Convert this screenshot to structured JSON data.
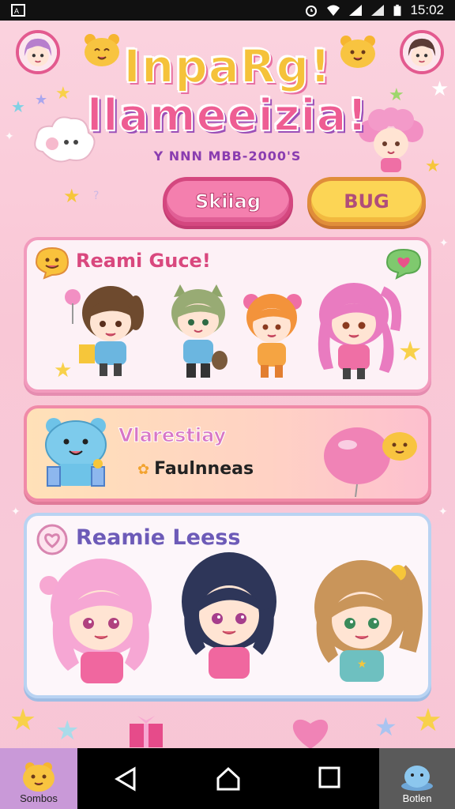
{
  "status_bar": {
    "left_icon": "app-notification-icon",
    "icons": [
      "alarm-icon",
      "wifi-icon",
      "signal-icon",
      "battery-icon"
    ],
    "time": "15:02"
  },
  "header": {
    "title_line_1": "InpaRg!",
    "title_line_2": "llameeizia!",
    "subtitle": "Y NNN MBB-2000'S",
    "left_avatar": "avatar-girl-icon",
    "right_avatar": "avatar-girl-icon"
  },
  "buttons": {
    "primary_label": "Skiiag",
    "secondary_label": "BUG"
  },
  "cards": [
    {
      "title": "Reami Guce!",
      "icon": "smile-speech-bubble-icon",
      "corner_icon": "heart-speech-bubble-icon"
    },
    {
      "title": "Vlarestiay",
      "subtitle": "Faulnneas",
      "icon": "bubble-bear-icon"
    },
    {
      "title": "Reamie Leess",
      "icon": "heart-badge-icon"
    }
  ],
  "bottom_nav": {
    "left_tab_label": "Sombos",
    "right_tab_label": "Botlen",
    "system_buttons": [
      "back-icon",
      "home-icon",
      "recents-icon"
    ]
  },
  "colors": {
    "background": "#fbd3df",
    "accent_pink": "#f47fae",
    "accent_yellow": "#fcd555",
    "card_border_pink": "#f29bbd",
    "card_border_blue": "#b9d3f2"
  }
}
